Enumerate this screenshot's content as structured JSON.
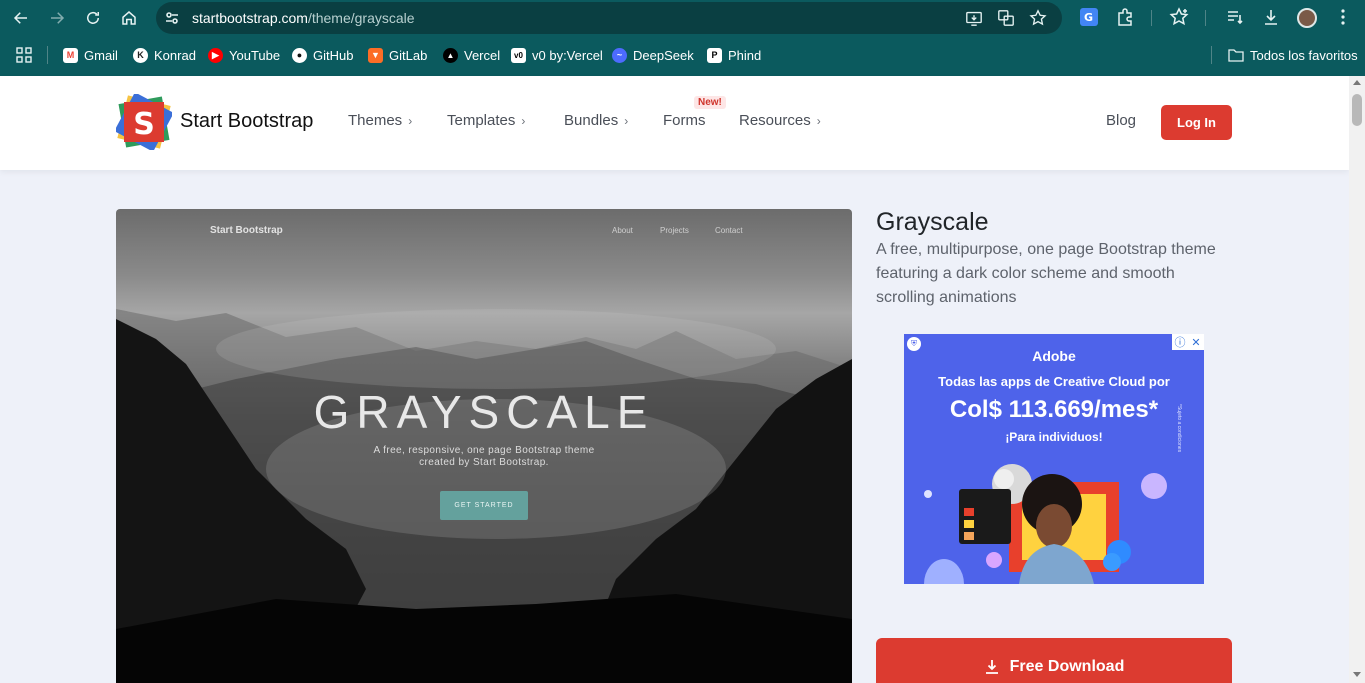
{
  "browser": {
    "url_domain": "startbootstrap.com",
    "url_path": "/theme/grayscale",
    "bookmarks": [
      {
        "label": "Gmail",
        "icon": "gmail-icon",
        "color": "#ea4335"
      },
      {
        "label": "Konrad",
        "icon": "konrad-icon",
        "color": "#ffffff"
      },
      {
        "label": "YouTube",
        "icon": "youtube-icon",
        "color": "#ff0000"
      },
      {
        "label": "GitHub",
        "icon": "github-icon",
        "color": "#ffffff"
      },
      {
        "label": "GitLab",
        "icon": "gitlab-icon",
        "color": "#fc6d26"
      },
      {
        "label": "Vercel",
        "icon": "vercel-icon",
        "color": "#000000"
      },
      {
        "label": "v0 by:Vercel",
        "icon": "v0-icon",
        "color": "#000000"
      },
      {
        "label": "DeepSeek",
        "icon": "deepseek-icon",
        "color": "#4d6bfe"
      },
      {
        "label": "Phind",
        "icon": "phind-icon",
        "color": "#000000"
      }
    ],
    "all_favorites": "Todos los favoritos"
  },
  "header": {
    "brand": "Start Bootstrap",
    "logo_letter": "S",
    "nav": [
      "Themes",
      "Templates",
      "Bundles",
      "Forms",
      "Resources"
    ],
    "new_badge": "New!",
    "blog": "Blog",
    "login": "Log In",
    "accent_color": "#dc3b30"
  },
  "preview": {
    "brand": "Start Bootstrap",
    "links": [
      "About",
      "Projects",
      "Contact"
    ],
    "title": "GRAYSCALE",
    "subtitle": "A free, responsive, one page Bootstrap theme created by Start Bootstrap.",
    "button": "GET STARTED"
  },
  "theme": {
    "title": "Grayscale",
    "description": "A free, multipurpose, one page Bootstrap theme featuring a dark color scheme and smooth scrolling animations"
  },
  "ad": {
    "brand": "Adobe",
    "line1": "Todas las apps de Creative Cloud por",
    "price": "Col$ 113.669/mes*",
    "line2": "¡Para individuos!",
    "background": "#4e63ea"
  },
  "download": {
    "label": "Free Download"
  }
}
